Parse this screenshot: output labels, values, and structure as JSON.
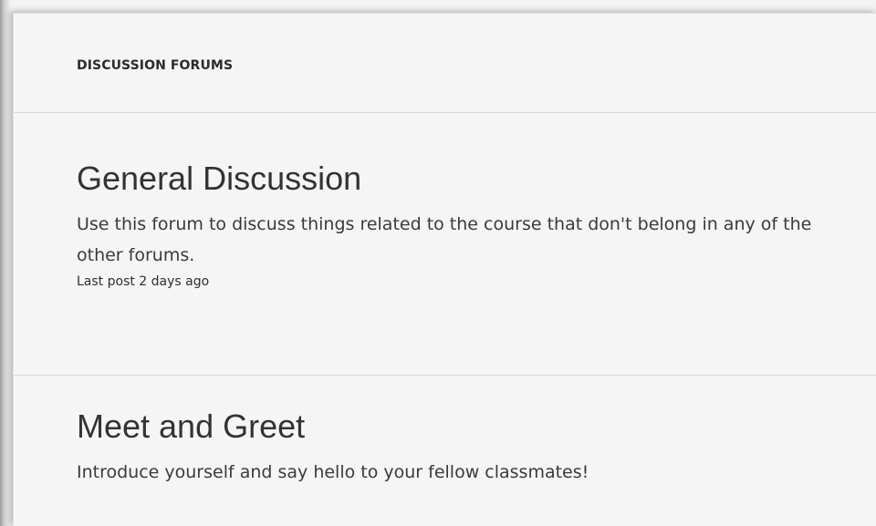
{
  "header": {
    "title": "DISCUSSION FORUMS"
  },
  "forums": [
    {
      "title": "General Discussion",
      "description": "Use this forum to discuss things related to the course that don't belong in any of the other forums.",
      "last_post": "Last post 2 days ago"
    },
    {
      "title": "Meet and Greet",
      "description": "Introduce yourself and say hello to your fellow classmates!"
    }
  ]
}
